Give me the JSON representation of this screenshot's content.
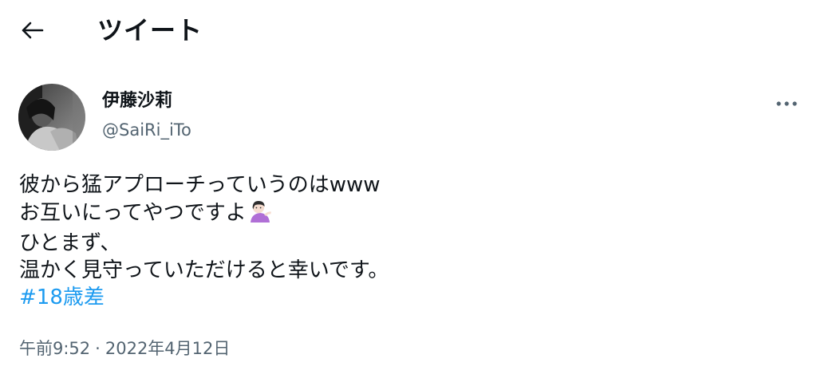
{
  "header": {
    "title": "ツイート",
    "back_icon": "arrow-left-icon"
  },
  "author": {
    "display_name": "伊藤沙莉",
    "handle": "@SaiRi_iTo",
    "avatar_icon": "profile-photo"
  },
  "more_icon": "more-horizontal-icon",
  "tweet": {
    "lines": [
      "彼から猛アプローチっていうのはwww",
      "お互いにってやつですよ",
      "ひとまず、",
      "温かく見守っていただけると幸いです。"
    ],
    "emoji": "person-tipping-hand-emoji",
    "hashtag": "#18歳差"
  },
  "meta": {
    "time": "午前9:52",
    "separator": "·",
    "date": "2022年4月12日"
  },
  "colors": {
    "text": "#0f1419",
    "secondary": "#536471",
    "link": "#1d9bf0",
    "background": "#ffffff"
  }
}
